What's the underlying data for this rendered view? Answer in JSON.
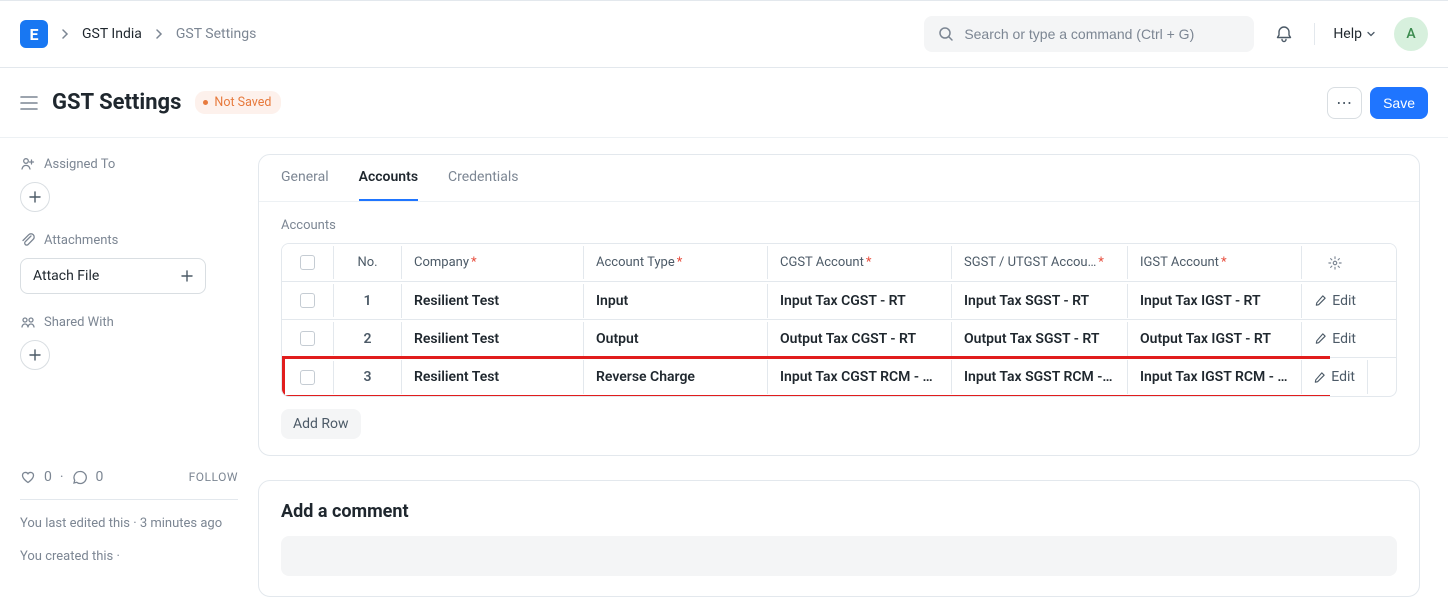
{
  "navbar": {
    "logo_letter": "E",
    "breadcrumbs": [
      "GST India",
      "GST Settings"
    ],
    "search_placeholder": "Search or type a command (Ctrl + G)",
    "help_label": "Help",
    "avatar_letter": "A"
  },
  "toolbar": {
    "title": "GST Settings",
    "status": "Not Saved",
    "more_label": "⋯",
    "save_label": "Save"
  },
  "sidebar": {
    "assigned_to_label": "Assigned To",
    "attachments_label": "Attachments",
    "attach_button": "Attach File",
    "shared_with_label": "Shared With",
    "likes": "0",
    "comments": "0",
    "follow_label": "FOLLOW",
    "timeline_1": "You last edited this · 3 minutes ago",
    "timeline_2": "You created this ·"
  },
  "main": {
    "tabs": [
      "General",
      "Accounts",
      "Credentials"
    ],
    "active_tab_index": 1,
    "section_label": "Accounts",
    "columns": {
      "no": "No.",
      "company": "Company",
      "account_type": "Account Type",
      "cgst": "CGST Account",
      "sgst": "SGST / UTGST Accou…",
      "igst": "IGST Account"
    },
    "edit_label": "Edit",
    "rows": [
      {
        "no": "1",
        "company": "Resilient Test",
        "account_type": "Input",
        "cgst": "Input Tax CGST - RT",
        "sgst": "Input Tax SGST - RT",
        "igst": "Input Tax IGST - RT",
        "highlighted": false
      },
      {
        "no": "2",
        "company": "Resilient Test",
        "account_type": "Output",
        "cgst": "Output Tax CGST - RT",
        "sgst": "Output Tax SGST - RT",
        "igst": "Output Tax IGST - RT",
        "highlighted": false
      },
      {
        "no": "3",
        "company": "Resilient Test",
        "account_type": "Reverse Charge",
        "cgst": "Input Tax CGST RCM - …",
        "sgst": "Input Tax SGST RCM - …",
        "igst": "Input Tax IGST RCM - RT",
        "highlighted": true
      }
    ],
    "add_row_label": "Add Row",
    "comment_title": "Add a comment"
  }
}
